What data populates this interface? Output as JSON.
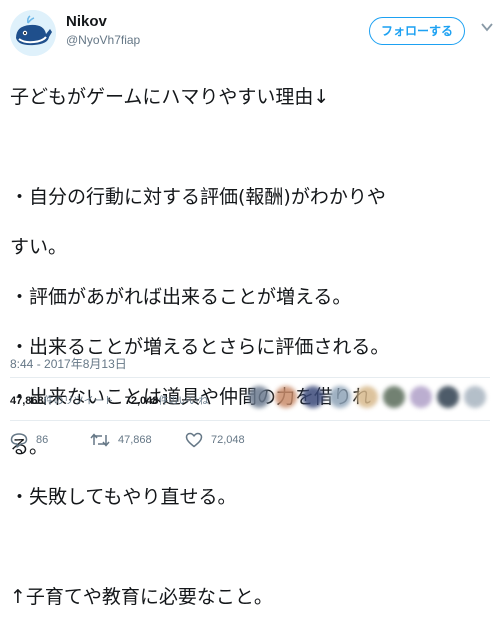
{
  "user": {
    "display_name": "Nikov",
    "handle": "@NyoVh7fiap",
    "follow_label": "フォローする",
    "avatar_icon": "whale-icon"
  },
  "tweet": {
    "lines": [
      "子どもがゲームにハマりやすい理由↓",
      "",
      "・自分の行動に対する評価(報酬)がわかりや",
      "すい。",
      "・評価があがれば出来ることが増える。",
      "・出来ることが増えるとさらに評価される。",
      "・出来ないことは道具や仲間の力を借りれ",
      "る。",
      "・失敗してもやり直せる。",
      "",
      "↑子育てや教育に必要なこと。"
    ],
    "timestamp": "8:44 - 2017年8月13日"
  },
  "stats": {
    "retweets": "47,868",
    "retweets_label": "件のリツイート",
    "likes": "72,048",
    "likes_label": "件のいいね"
  },
  "actions": {
    "reply_icon": "reply-icon",
    "reply_count": "86",
    "retweet_icon": "retweet-icon",
    "retweet_count": "47,868",
    "like_icon": "heart-icon",
    "like_count": "72,048"
  },
  "colors": {
    "accent": "#1da1f2",
    "muted": "#657786",
    "text": "#14171a",
    "divider": "#e6ecf0"
  }
}
